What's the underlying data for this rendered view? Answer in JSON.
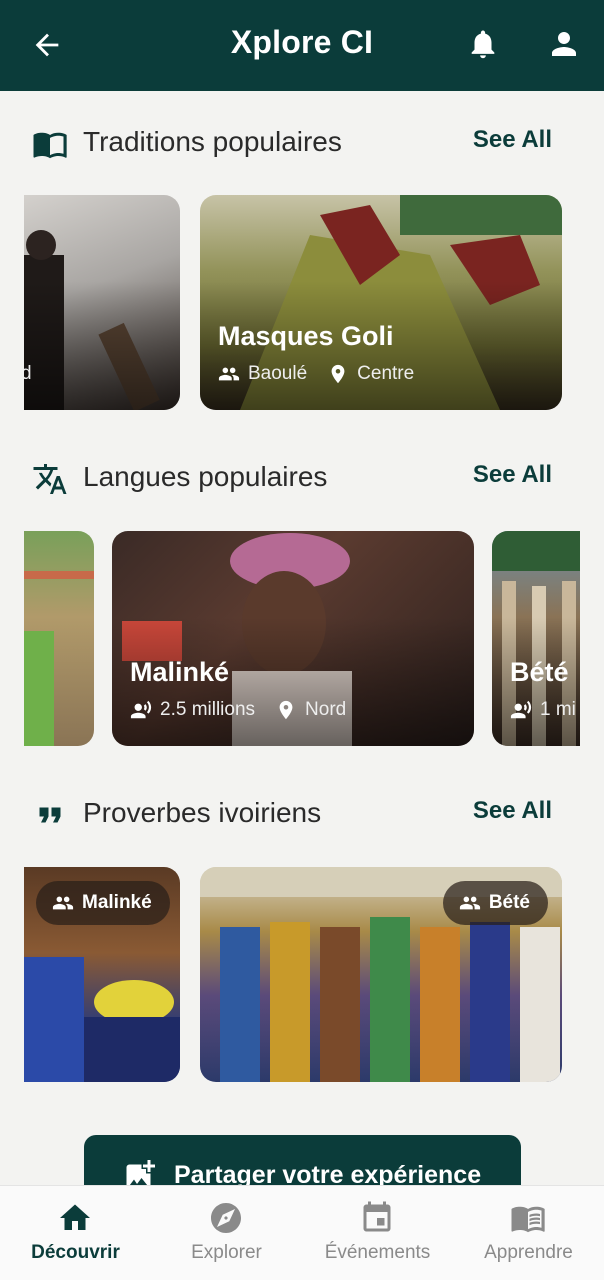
{
  "app": {
    "title": "Xplore CI"
  },
  "sections": {
    "traditions": {
      "title": "Traditions populaires",
      "see_all": "See All",
      "cards": [
        {
          "partial_label": "e-sud"
        },
        {
          "name": "Masques Goli",
          "ethnic_group": "Baoulé",
          "region": "Centre"
        }
      ]
    },
    "languages": {
      "title": "Langues populaires",
      "see_all": "See All",
      "cards": [
        {
          "name": "Malinké",
          "speakers": "2.5 millions",
          "region": "Nord"
        },
        {
          "name": "Bété",
          "speakers_partial": "1 mi"
        }
      ]
    },
    "proverbs": {
      "title": "Proverbes ivoiriens",
      "see_all": "See All",
      "cards": [
        {
          "badge": "Malinké"
        },
        {
          "badge": "Bété"
        }
      ]
    }
  },
  "share_button": {
    "label": "Partager votre expérience"
  },
  "bottom_nav": {
    "items": [
      {
        "label": "Découvrir",
        "icon": "home-icon",
        "active": true
      },
      {
        "label": "Explorer",
        "icon": "compass-icon",
        "active": false
      },
      {
        "label": "Événements",
        "icon": "calendar-icon",
        "active": false
      },
      {
        "label": "Apprendre",
        "icon": "book-icon",
        "active": false
      }
    ]
  },
  "colors": {
    "primary": "#0b3c3a",
    "background": "#f3f3f1",
    "nav_inactive": "#8a8a8a"
  }
}
